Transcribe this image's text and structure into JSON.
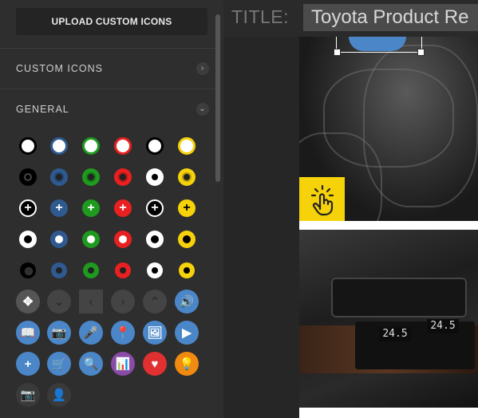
{
  "sidebar": {
    "upload_button": "UPLOAD CUSTOM ICONS",
    "sections": [
      {
        "label": "CUSTOM ICONS",
        "state": "collapsed",
        "chevron": "chevron-right-icon"
      },
      {
        "label": "GENERAL",
        "state": "expanded",
        "chevron": "chevron-down-icon"
      }
    ],
    "palette_colors": [
      "#000000",
      "#2f5a8f",
      "#1e9a1e",
      "#e82020",
      "#ffffff",
      "#f5d20a"
    ],
    "icon_rows": [
      {
        "style": "ring-white-center",
        "names": [
          "dot-black",
          "dot-navy",
          "dot-green",
          "dot-red",
          "dot-white",
          "dot-yellow"
        ]
      },
      {
        "style": "target",
        "names": [
          "target-black",
          "target-navy",
          "target-green",
          "target-red",
          "target-white",
          "target-yellow"
        ]
      },
      {
        "style": "plus",
        "names": [
          "plus-black",
          "plus-navy",
          "plus-green",
          "plus-red",
          "plus-white",
          "plus-yellow"
        ]
      },
      {
        "style": "ring-dark-center",
        "names": [
          "ring-black",
          "ring-navy",
          "ring-green",
          "ring-red",
          "ring-white",
          "ring-yellow"
        ]
      },
      {
        "style": "small-target",
        "names": [
          "small-black",
          "small-navy",
          "small-green",
          "small-red",
          "small-white",
          "small-yellow"
        ]
      }
    ],
    "glyph_rows": [
      [
        {
          "name": "move-icon",
          "glyph": "✥",
          "bg": "#555555"
        },
        {
          "name": "chevron-down-icon",
          "glyph": "⌄",
          "bg": "#444444"
        },
        {
          "name": "chevron-left-icon",
          "glyph": "‹",
          "bg": "#444444"
        },
        {
          "name": "chevron-right-icon",
          "glyph": "›",
          "bg": "#444444"
        },
        {
          "name": "chevron-up-icon",
          "glyph": "⌃",
          "bg": "#444444"
        },
        {
          "name": "volume-icon",
          "glyph": "🔊",
          "bg": "#4a86c8"
        }
      ],
      [
        {
          "name": "book-icon",
          "glyph": "📖",
          "bg": "#4a86c8"
        },
        {
          "name": "camera-icon",
          "glyph": "📷",
          "bg": "#4a86c8"
        },
        {
          "name": "microphone-icon",
          "glyph": "🎤",
          "bg": "#4a86c8"
        },
        {
          "name": "map-pin-icon",
          "glyph": "📍",
          "bg": "#4a86c8"
        },
        {
          "name": "image-icon",
          "glyph": "🖼",
          "bg": "#4a86c8"
        },
        {
          "name": "play-icon",
          "glyph": "▶",
          "bg": "#4a86c8"
        }
      ],
      [
        {
          "name": "plus-icon",
          "glyph": "+",
          "bg": "#4a86c8"
        },
        {
          "name": "cart-icon",
          "glyph": "🛒",
          "bg": "#4a86c8"
        },
        {
          "name": "search-icon",
          "glyph": "🔍",
          "bg": "#4a86c8"
        },
        {
          "name": "bar-chart-icon",
          "glyph": "📊",
          "bg": "#8a4aa8"
        },
        {
          "name": "heart-icon",
          "glyph": "♥",
          "bg": "#e03030"
        },
        {
          "name": "lightbulb-icon",
          "glyph": "💡",
          "bg": "#f08a10"
        }
      ],
      [
        {
          "name": "camera-outline-icon",
          "glyph": "📷",
          "bg": "#3a3a3a"
        },
        {
          "name": "user-icon",
          "glyph": "👤",
          "bg": "#3a3a3a"
        }
      ]
    ]
  },
  "editor": {
    "title_label": "TITLE:",
    "title_value": "Toyota Product Re",
    "hotspot_icon": "tap-hand-icon",
    "hotspot_color": "#f5d20a",
    "selected_icon_color": "#4a86c8",
    "dashboard_display_left": "24.5",
    "dashboard_display_right": "24.5"
  }
}
